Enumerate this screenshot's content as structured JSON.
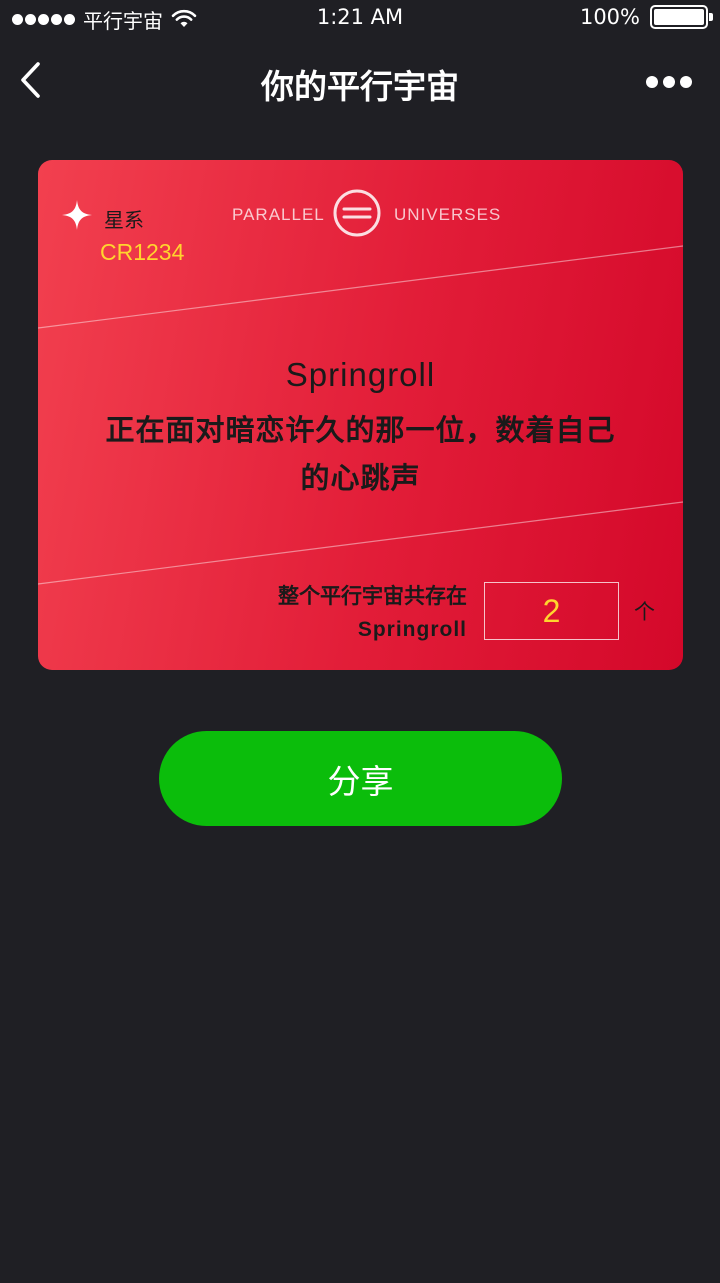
{
  "status_bar": {
    "carrier": "平行宇宙",
    "time": "1:21 AM",
    "battery": "100%"
  },
  "nav": {
    "title": "你的平行宇宙",
    "back_icon": "chevron-left-icon",
    "more_icon": "more-dots-icon"
  },
  "card": {
    "galaxy_label": "星系",
    "galaxy_code": "CR1234",
    "brand_left": "PARALLEL",
    "brand_right": "UNIVERSES",
    "name": "Springroll",
    "quote": "正在面对暗恋许久的那一位，数着自己的心跳声",
    "count_label_line1": "整个平行宇宙共存在",
    "count_label_line2": "Springroll",
    "count_value": "2",
    "count_unit": "个",
    "colors": {
      "card_start": "#f2404f",
      "card_end": "#d4082a",
      "highlight": "#ffd52e"
    }
  },
  "share": {
    "label": "分享",
    "color": "#0bbd0b"
  },
  "colors": {
    "background": "#1f1f24"
  }
}
